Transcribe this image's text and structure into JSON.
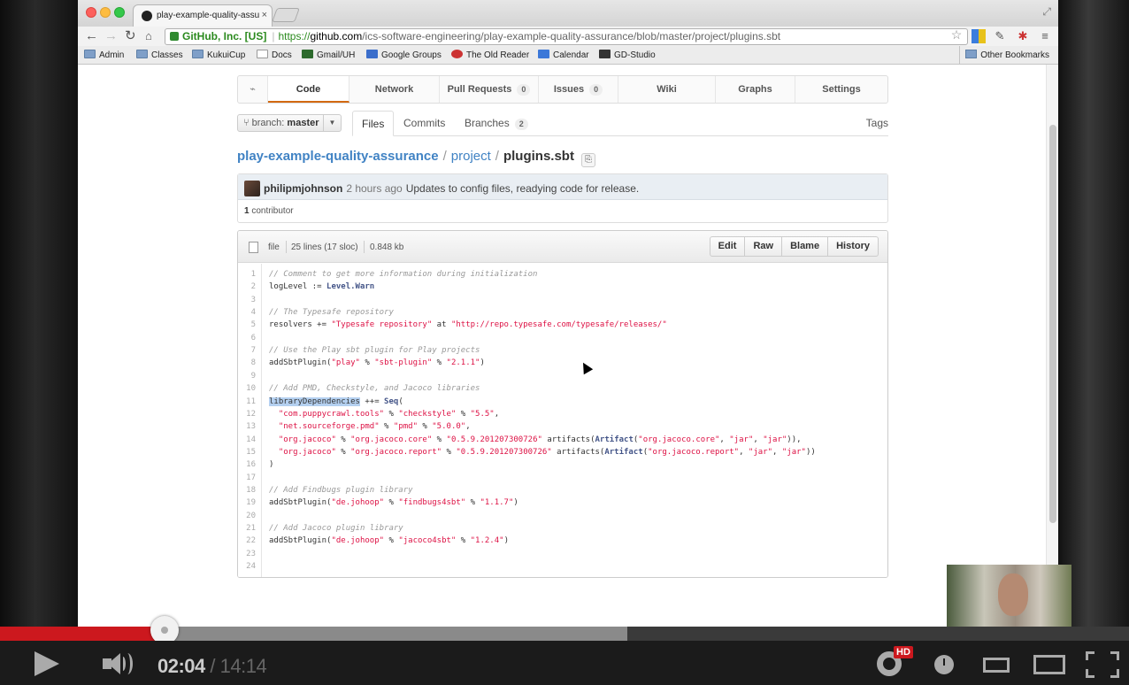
{
  "browser": {
    "tab_title": "play-example-quality-assu",
    "tab_close": "×",
    "cert_label": "GitHub, Inc. [US]",
    "url_scheme": "https://",
    "url_host": "github.com",
    "url_path": "/ics-software-engineering/play-example-quality-assurance/blob/master/project/plugins.sbt",
    "bookmarks": [
      "Admin",
      "Classes",
      "KukuiCup",
      "Docs",
      "Gmail/UH",
      "Google Groups",
      "The Old Reader",
      "Calendar",
      "GD-Studio"
    ],
    "other_bookmarks": "Other Bookmarks"
  },
  "repo_nav": {
    "items": [
      "Code",
      "Network",
      "Pull Requests",
      "Issues",
      "Wiki",
      "Graphs",
      "Settings"
    ],
    "pull_requests_count": "0",
    "issues_count": "0"
  },
  "branch": {
    "label": "branch:",
    "name": "master"
  },
  "subnav": {
    "files": "Files",
    "commits": "Commits",
    "branches": "Branches",
    "branches_count": "2",
    "tags": "Tags"
  },
  "breadcrumb": {
    "repo": "play-example-quality-assurance",
    "sep": "/",
    "dir": "project",
    "file": "plugins.sbt"
  },
  "commit": {
    "author": "philipmjohnson",
    "ago": "2 hours ago",
    "message": "Updates to config files, readying code for release.",
    "contributors_count": "1",
    "contributors_label": "contributor"
  },
  "file": {
    "mode": "file",
    "lines": "25 lines (17 sloc)",
    "size": "0.848 kb",
    "buttons": [
      "Edit",
      "Raw",
      "Blame",
      "History"
    ]
  },
  "code_lines": [
    "// Comment to get more information during initialization",
    "logLevel := Level.Warn",
    "",
    "// The Typesafe repository",
    "resolvers += \"Typesafe repository\" at \"http://repo.typesafe.com/typesafe/releases/\"",
    "",
    "// Use the Play sbt plugin for Play projects",
    "addSbtPlugin(\"play\" % \"sbt-plugin\" % \"2.1.1\")",
    "",
    "// Add PMD, Checkstyle, and Jacoco libraries",
    "libraryDependencies ++= Seq(",
    "  \"com.puppycrawl.tools\" % \"checkstyle\" % \"5.5\",",
    "  \"net.sourceforge.pmd\" % \"pmd\" % \"5.0.0\",",
    "  \"org.jacoco\" % \"org.jacoco.core\" % \"0.5.9.201207300726\" artifacts(Artifact(\"org.jacoco.core\", \"jar\", \"jar\")),",
    "  \"org.jacoco\" % \"org.jacoco.report\" % \"0.5.9.201207300726\" artifacts(Artifact(\"org.jacoco.report\", \"jar\", \"jar\"))",
    ")",
    "",
    "// Add Findbugs plugin library",
    "addSbtPlugin(\"de.johoop\" % \"findbugs4sbt\" % \"1.1.7\")",
    "",
    "// Add Jacoco plugin library",
    "addSbtPlugin(\"de.johoop\" % \"jacoco4sbt\" % \"1.2.4\")",
    "",
    ""
  ],
  "highlighted_token": "libraryDependencies",
  "player": {
    "current_time": "02:04",
    "time_separator": "/",
    "duration": "14:14",
    "hd_badge": "HD",
    "played_fraction": 0.146,
    "buffered_fraction": 0.556
  }
}
